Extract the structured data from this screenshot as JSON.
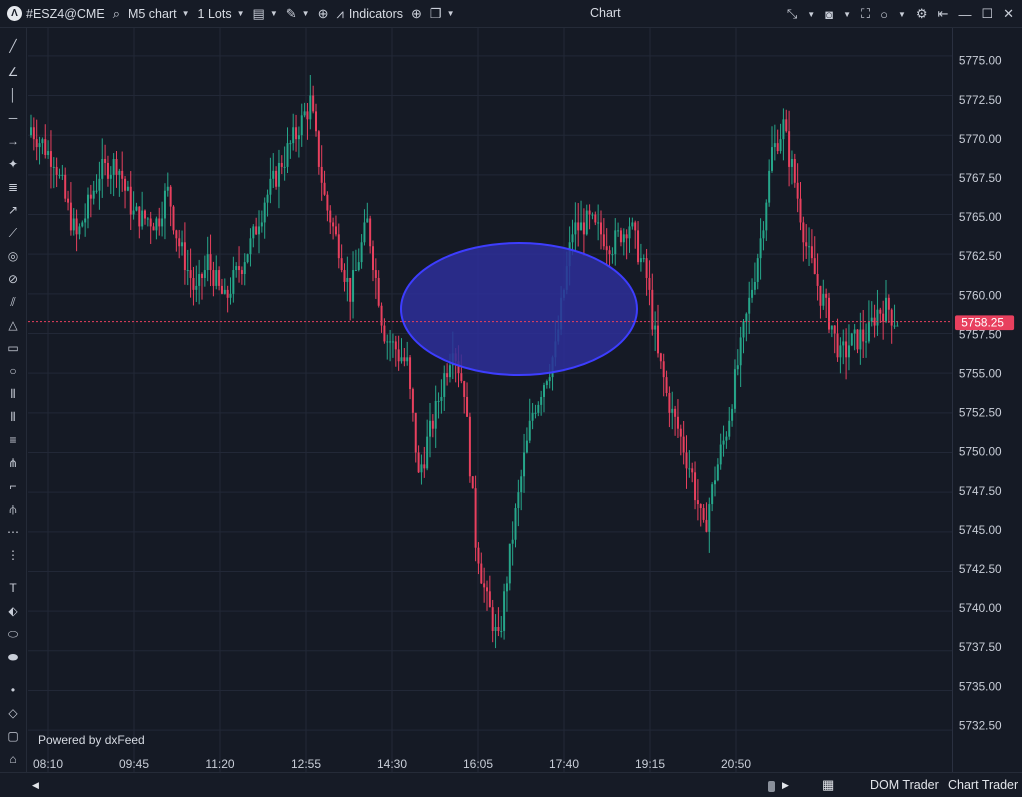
{
  "toolbar": {
    "symbol": "#ESZ4@CME",
    "timeframe": "M5 chart",
    "lots": "1 Lots",
    "indicators": "Indicators",
    "window_title": "Chart"
  },
  "footer": {
    "powered_by": "Powered by dxFeed",
    "dom_trader": "DOM Trader",
    "chart_trader": "Chart Trader"
  },
  "colors": {
    "background": "#151a25",
    "up": "#26a68a",
    "down": "#e8405e",
    "ellipse_stroke": "#3d3dff",
    "ellipse_fill": "#2d2f9a",
    "price_line": "#e8405e"
  },
  "chart_data": {
    "type": "candlestick",
    "symbol": "#ESZ4@CME",
    "interval": "M5",
    "current_price": 5758.25,
    "current_price_label": "5758.25",
    "ylim": [
      5731.5,
      5776.0
    ],
    "y_ticks": [
      "5775.00",
      "5772.50",
      "5770.00",
      "5767.50",
      "5765.00",
      "5762.50",
      "5760.00",
      "5757.50",
      "5755.00",
      "5752.50",
      "5750.00",
      "5747.50",
      "5745.00",
      "5742.50",
      "5740.00",
      "5737.50",
      "5735.00",
      "5732.50"
    ],
    "x_ticks": [
      "08:10",
      "09:45",
      "11:20",
      "12:55",
      "14:30",
      "16:05",
      "17:40",
      "19:15",
      "20:50"
    ],
    "grid": true,
    "close_path": [
      [
        0,
        5770.5
      ],
      [
        8,
        5768.5
      ],
      [
        12,
        5766.0
      ],
      [
        16,
        5763.5
      ],
      [
        24,
        5767.5
      ],
      [
        30,
        5768.3
      ],
      [
        36,
        5765.0
      ],
      [
        44,
        5764.5
      ],
      [
        48,
        5766.5
      ],
      [
        52,
        5763.0
      ],
      [
        58,
        5760.0
      ],
      [
        62,
        5762.0
      ],
      [
        68,
        5759.5
      ],
      [
        74,
        5762.0
      ],
      [
        78,
        5763.5
      ],
      [
        82,
        5766.0
      ],
      [
        90,
        5769.0
      ],
      [
        98,
        5772.0
      ],
      [
        103,
        5766.0
      ],
      [
        108,
        5763.0
      ],
      [
        112,
        5760.0
      ],
      [
        116,
        5763.0
      ],
      [
        118,
        5764.5
      ],
      [
        124,
        5757.5
      ],
      [
        132,
        5755.5
      ],
      [
        136,
        5748.5
      ],
      [
        144,
        5754.0
      ],
      [
        148,
        5757.0
      ],
      [
        152,
        5754.0
      ],
      [
        156,
        5744.5
      ],
      [
        160,
        5740.5
      ],
      [
        164,
        5738.0
      ],
      [
        168,
        5743.5
      ],
      [
        172,
        5748.5
      ],
      [
        176,
        5752.5
      ],
      [
        180,
        5754.5
      ],
      [
        184,
        5756.5
      ],
      [
        190,
        5764.0
      ],
      [
        196,
        5764.5
      ],
      [
        204,
        5763.0
      ],
      [
        210,
        5764.5
      ],
      [
        216,
        5761.0
      ],
      [
        220,
        5756.0
      ],
      [
        224,
        5753.0
      ],
      [
        228,
        5751.0
      ],
      [
        232,
        5748.5
      ],
      [
        236,
        5745.0
      ],
      [
        240,
        5748.5
      ],
      [
        244,
        5751.5
      ],
      [
        248,
        5755.5
      ],
      [
        252,
        5759.5
      ],
      [
        256,
        5763.5
      ],
      [
        260,
        5769.0
      ],
      [
        264,
        5770.5
      ],
      [
        268,
        5767.0
      ],
      [
        272,
        5763.0
      ],
      [
        276,
        5760.5
      ],
      [
        280,
        5758.5
      ],
      [
        284,
        5756.0
      ],
      [
        288,
        5757.0
      ],
      [
        294,
        5757.5
      ],
      [
        297,
        5759.0
      ],
      [
        301,
        5759.0
      ],
      [
        304,
        5758.25
      ]
    ]
  }
}
